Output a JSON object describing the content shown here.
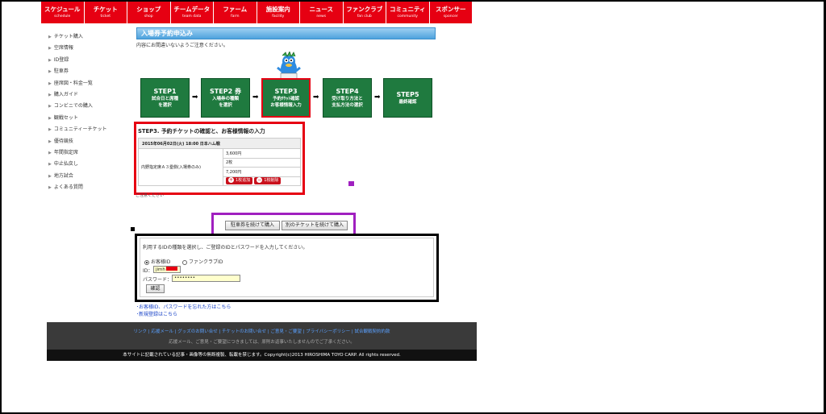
{
  "nav": [
    {
      "jp": "スケジュール",
      "en": "schedule"
    },
    {
      "jp": "チケット",
      "en": "ticket"
    },
    {
      "jp": "ショップ",
      "en": "shop"
    },
    {
      "jp": "チームデータ",
      "en": "team data"
    },
    {
      "jp": "ファーム",
      "en": "farm"
    },
    {
      "jp": "施設案内",
      "en": "facility"
    },
    {
      "jp": "ニュース",
      "en": "news"
    },
    {
      "jp": "ファンクラブ",
      "en": "fan club"
    },
    {
      "jp": "コミュニティ",
      "en": "community"
    },
    {
      "jp": "スポンサー",
      "en": "sponcer"
    }
  ],
  "sidebar": [
    "チケット購入",
    "空席情報",
    "ID登録",
    "駐車券",
    "座席図・料金一覧",
    "購入ガイド",
    "コンビニでの購入",
    "観戦セット",
    "コミュニティーチケット",
    "優待競技",
    "年間指定席",
    "中止払戻し",
    "地方試合",
    "よくある質問"
  ],
  "page": {
    "title": "入場券予約申込み",
    "note": "内容にお間違いないようご注意ください。"
  },
  "steps": [
    {
      "head": "STEP1",
      "l1": "試合日と席種",
      "l2": "を選択"
    },
    {
      "head": "STEP2 券",
      "l1": "入場券の種類",
      "l2": "を選択"
    },
    {
      "head": "STEP3",
      "l1": "予約ﾁｹｯﾄ確認",
      "l2": "お客様情報入力"
    },
    {
      "head": "STEP4",
      "l1": "受け取り方法と",
      "l2": "支払方法の選択"
    },
    {
      "head": "STEP5",
      "l1": "最終確認",
      "l2": ""
    }
  ],
  "step3": {
    "heading": "STEP3. 予約チケットの確認と、お客様情報の入力",
    "game": "2015年06月02日(火) 18:00 日本ハム戦",
    "seat": "内野指定席Ａ３塁側(入場券のみ)",
    "price": "3,600円",
    "qty": "2枚",
    "total": "7,200円",
    "add_label": "1枚追加",
    "remove_label": "1枚削除"
  },
  "below_note": "ご注意ください",
  "buttons": {
    "parking": "駐車券を続けて購入",
    "another": "別のチケットを続けて購入"
  },
  "login": {
    "instruction": "利用するIDの種類を選択し、ご登録のIDとパスワードを入力してください。",
    "radio_customer": "お客様ID",
    "radio_fanclub": "ファンクラブID",
    "id_label": "ID：",
    "id_value": "jimh",
    "password_label": "パスワード：",
    "password_value": "••••••••",
    "confirm": "確認"
  },
  "links": {
    "forgot": "･お客様ID、パスワードを忘れた方はこちら",
    "register": "･新規登録はこちら"
  },
  "footer": {
    "links": "リンク | 応援メール | グッズのお問い合せ | チケットのお問い合せ | ご意見・ご要望 | プライバシーポリシー | 試合観戦契約約款",
    "note": "応援メール、ご意見・ご要望につきましては、原則お返事いたしませんのでご了承ください。",
    "copyright": "本サイトに記載されている記事・画像等の無断複製、転載を禁じます。Copyright(c)2013 HIROSHIMA TOYO CARP. All rights reserved."
  },
  "colors": {
    "brand_red": "#e60012",
    "step_green": "#1f7a3f",
    "highlight_purple": "#a020c0",
    "title_blue": "#4ea2dd"
  }
}
